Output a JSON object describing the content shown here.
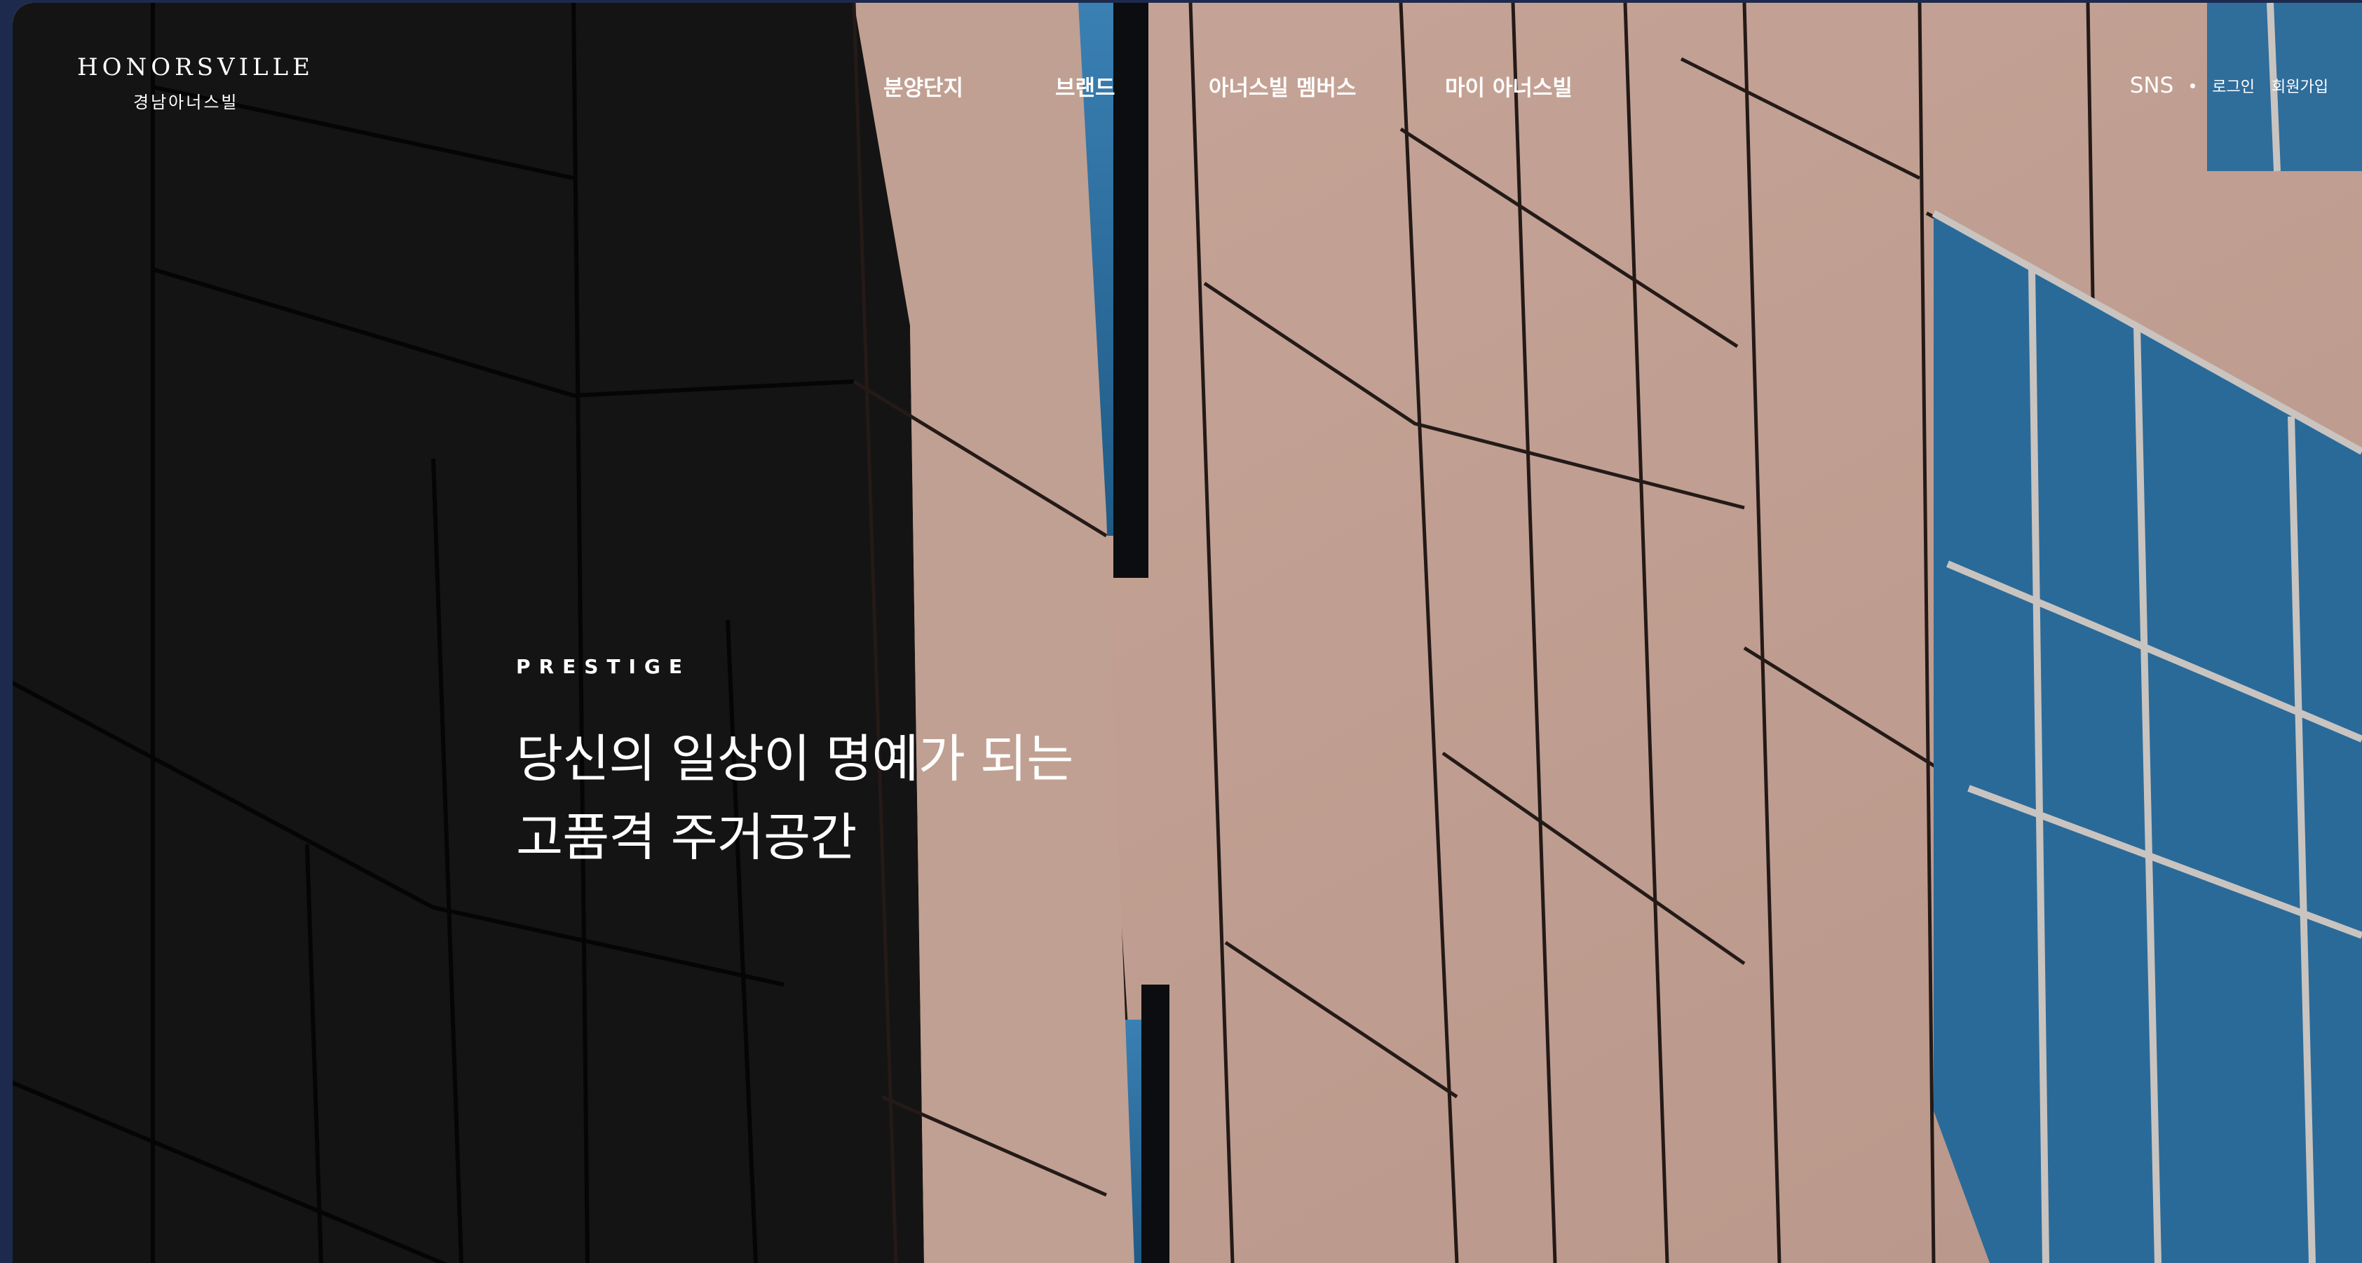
{
  "header": {
    "logo_en": "HONORSVILLE",
    "logo_ko": "경남아너스빌",
    "nav": [
      {
        "label": "분양단지"
      },
      {
        "label": "브랜드"
      },
      {
        "label": "아너스빌 멤버스"
      },
      {
        "label": "마이 아너스빌"
      }
    ],
    "utility": {
      "sns": "SNS",
      "login": "로그인",
      "signup": "회원가입"
    }
  },
  "hero": {
    "eyebrow": "PRESTIGE",
    "headline_line1": "당신의 일상이 명예가 되는",
    "headline_line2": "고품격 주거공간"
  },
  "colors": {
    "page_background": "#1d2a4e",
    "facade_panel": "#c7a697",
    "shadow": "#141313",
    "glass": "#2f6d9b",
    "text": "#ffffff"
  }
}
